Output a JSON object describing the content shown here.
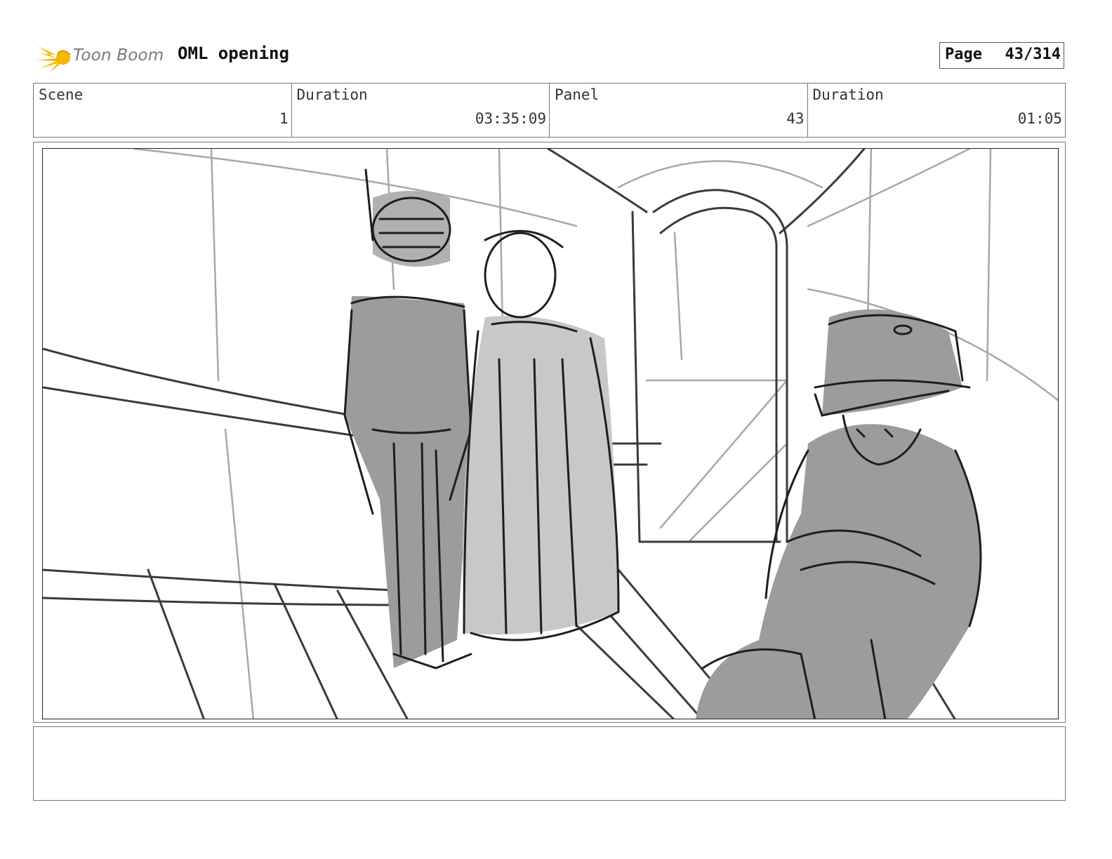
{
  "header": {
    "logo_text": "Toon Boom",
    "project_title": "OML opening",
    "page_label": "Page",
    "page_number": "43/314"
  },
  "info": {
    "scene_label": "Scene",
    "scene_value": "1",
    "scene_duration_label": "Duration",
    "scene_duration_value": "03:35:09",
    "panel_label": "Panel",
    "panel_value": "43",
    "panel_duration_label": "Duration",
    "panel_duration_value": "01:05"
  },
  "panel": {
    "description": ""
  },
  "colors": {
    "logo_yellow": "#f5b800",
    "sketch_dark": "#2a2a2a",
    "sketch_light": "#9a9a9a",
    "fill_light": "#c8c8c8",
    "fill_mid": "#9c9c9c"
  }
}
